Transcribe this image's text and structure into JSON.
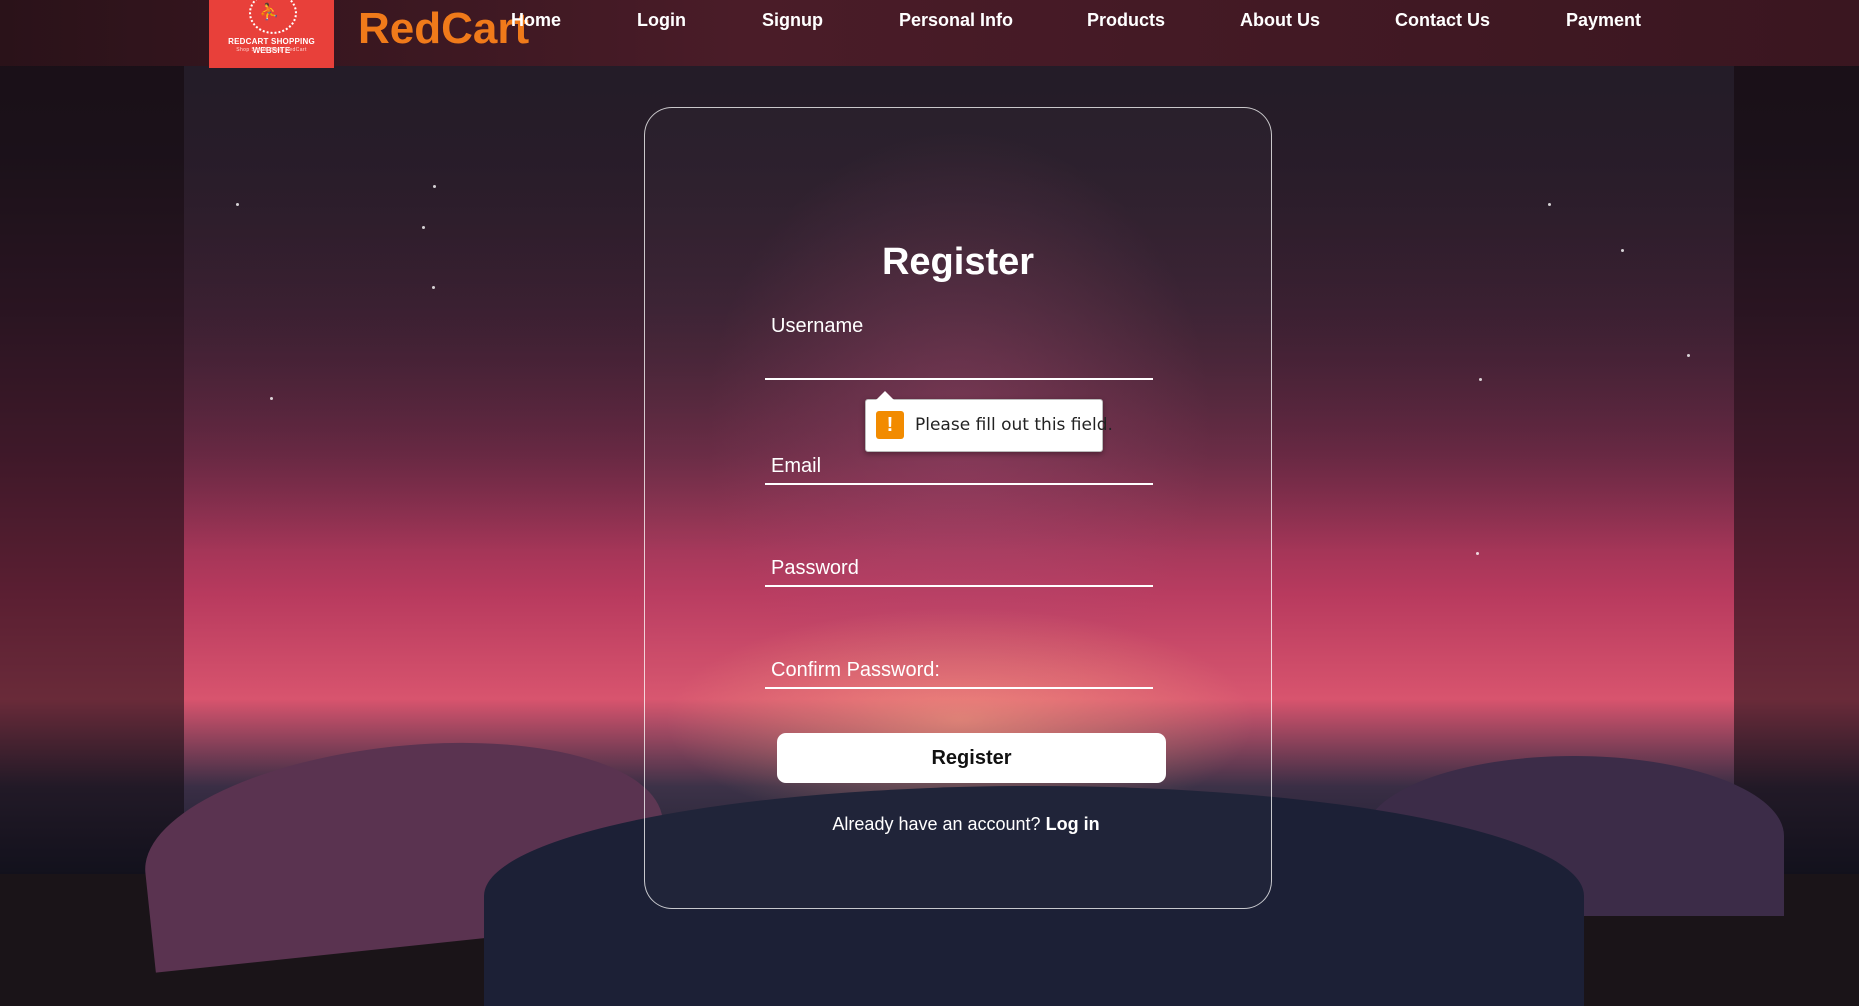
{
  "brand": {
    "logo_title": "REDCART SHOPPING WEBSITE",
    "logo_tagline": "Shop Smart, Shop RedCart",
    "name": "RedCart"
  },
  "nav": {
    "items": [
      "Home",
      "Login",
      "Signup",
      "Personal Info",
      "Products",
      "About Us",
      "Contact Us",
      "Payment"
    ]
  },
  "form": {
    "title": "Register",
    "username_label": "Username",
    "email_label": "Email",
    "password_label": "Password",
    "confirm_label": "Confirm Password:",
    "submit_label": "Register",
    "login_prompt": "Already have an account?",
    "login_link": "Log in"
  },
  "tooltip": {
    "message": "Please fill out this field.",
    "icon": "warning-icon",
    "color": "#f28b00"
  },
  "colors": {
    "brand_text": "#f07a1a",
    "logo_bg": "#e8403a"
  }
}
